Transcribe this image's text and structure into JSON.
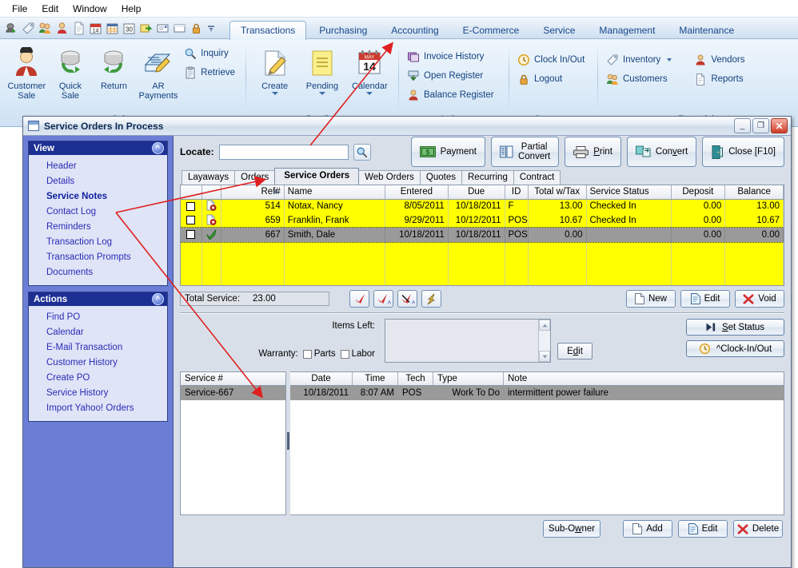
{
  "menu": {
    "items": [
      "File",
      "Edit",
      "Window",
      "Help"
    ]
  },
  "quick_toolbar": {
    "icons": [
      "customer-card-icon",
      "tag-icon",
      "customers-icon",
      "customer-icon",
      "document-icon",
      "calendar-icon",
      "spreadsheet-icon",
      "day-30-icon",
      "transfer-icon",
      "receipt-icon",
      "window-icon",
      "lock-icon",
      "dropdown-icon"
    ]
  },
  "ribbon": {
    "tabs": [
      {
        "label": "Transactions",
        "active": true
      },
      {
        "label": "Purchasing",
        "active": false
      },
      {
        "label": "Accounting",
        "active": false
      },
      {
        "label": "E-Commerce",
        "active": false
      },
      {
        "label": "Service",
        "active": false
      },
      {
        "label": "Management",
        "active": false
      },
      {
        "label": "Maintenance",
        "active": false
      }
    ],
    "groups": [
      {
        "title": "Sales",
        "big_buttons": [
          {
            "label_line1": "Customer",
            "label_line2": "Sale",
            "icon": "customer-sale-icon"
          },
          {
            "label_line1": "Quick",
            "label_line2": "Sale",
            "icon": "quick-sale-icon"
          },
          {
            "label_line1": "Return",
            "label_line2": "",
            "icon": "return-icon"
          },
          {
            "label_line1": "AR",
            "label_line2": "Payments",
            "icon": "ar-payments-icon"
          }
        ],
        "small_buttons": [
          {
            "label": "Inquiry",
            "icon": "inquiry-icon"
          },
          {
            "label": "Retrieve",
            "icon": "retrieve-icon"
          }
        ]
      },
      {
        "title": "Pending",
        "big_buttons": [
          {
            "label_line1": "Create",
            "label_line2": "",
            "icon": "create-icon",
            "caret": true
          },
          {
            "label_line1": "Pending",
            "label_line2": "",
            "icon": "pending-icon",
            "caret": true
          },
          {
            "label_line1": "Calendar",
            "label_line2": "",
            "icon": "calendar-icon",
            "caret": true
          }
        ],
        "small_buttons": []
      },
      {
        "title": "Actions",
        "big_buttons": [],
        "small_buttons": [
          {
            "label": "Invoice History",
            "icon": "invoice-history-icon"
          },
          {
            "label": "Open Register",
            "icon": "open-register-icon"
          },
          {
            "label": "Balance Register",
            "icon": "balance-register-icon"
          }
        ]
      },
      {
        "title": "Summary",
        "big_buttons": [],
        "small_buttons": [
          {
            "label": "Clock In/Out",
            "icon": "clock-icon"
          },
          {
            "label": "Logout",
            "icon": "lock-icon"
          }
        ]
      },
      {
        "title": "Essentials",
        "big_buttons": [],
        "small_buttons": [
          {
            "label": "Inventory",
            "icon": "inventory-tag-icon",
            "caret": true
          },
          {
            "label": "Customers",
            "icon": "customers-icon"
          }
        ],
        "small_buttons2": [
          {
            "label": "Vendors",
            "icon": "vendors-icon"
          },
          {
            "label": "Reports",
            "icon": "reports-icon"
          }
        ]
      }
    ]
  },
  "window": {
    "title": "Service Orders In Process",
    "minimize": "_",
    "maximize": "❐",
    "close": "✕"
  },
  "sidebar": {
    "panels": [
      {
        "title": "View",
        "items": [
          {
            "label": "Header",
            "selected": false
          },
          {
            "label": "Details",
            "selected": false
          },
          {
            "label": "Service Notes",
            "selected": true
          },
          {
            "label": "Contact Log",
            "selected": false
          },
          {
            "label": "Reminders",
            "selected": false
          },
          {
            "label": "Transaction Log",
            "selected": false
          },
          {
            "label": "Transaction Prompts",
            "selected": false
          },
          {
            "label": "Documents",
            "selected": false
          }
        ]
      },
      {
        "title": "Actions",
        "items": [
          {
            "label": "Find PO",
            "selected": false
          },
          {
            "label": "Calendar",
            "selected": false
          },
          {
            "label": "E-Mail Transaction",
            "selected": false
          },
          {
            "label": "Customer History",
            "selected": false
          },
          {
            "label": "Create PO",
            "selected": false
          },
          {
            "label": "Service History",
            "selected": false
          },
          {
            "label": "Import Yahoo! Orders",
            "selected": false
          }
        ]
      }
    ]
  },
  "locate": {
    "label": "Locate:",
    "value": "",
    "placeholder": ""
  },
  "top_buttons": [
    {
      "line1": "Payment",
      "line2": "",
      "icon": "money-icon"
    },
    {
      "line1": "Partial",
      "line2": "Convert",
      "icon": "partial-convert-icon"
    },
    {
      "line1": "Print",
      "line2": "",
      "icon": "printer-icon"
    },
    {
      "line1": "Convert",
      "line2": "",
      "icon": "convert-icon"
    },
    {
      "line1": "Close [F10]",
      "line2": "",
      "icon": "door-exit-icon"
    }
  ],
  "doc_tabs": [
    {
      "label": "Layaways",
      "active": false
    },
    {
      "label": "Orders",
      "active": false
    },
    {
      "label": "Service Orders",
      "active": true
    },
    {
      "label": "Web Orders",
      "active": false
    },
    {
      "label": "Quotes",
      "active": false
    },
    {
      "label": "Recurring",
      "active": false
    },
    {
      "label": "Contract",
      "active": false
    }
  ],
  "grid": {
    "columns": [
      "",
      "",
      "Ref#",
      "Name",
      "Entered",
      "Due",
      "ID",
      "Total w/Tax",
      "Service Status",
      "Deposit",
      "Balance"
    ],
    "sort_column": "Ref#",
    "sort_direction": "asc",
    "rows": [
      {
        "checked": false,
        "status_icon": "alert-doc-icon",
        "ref": "514",
        "name": "Notax, Nancy",
        "entered": "8/05/2011",
        "due": "10/18/2011",
        "id": "F",
        "total": "13.00",
        "service_status": "Checked In",
        "deposit": "0.00",
        "balance": "13.00",
        "selected": false
      },
      {
        "checked": false,
        "status_icon": "alert-doc-icon",
        "ref": "659",
        "name": "Franklin, Frank",
        "entered": "9/29/2011",
        "due": "10/12/2011",
        "id": "POS",
        "total": "10.67",
        "service_status": "Checked In",
        "deposit": "0.00",
        "balance": "10.67",
        "selected": false
      },
      {
        "checked": false,
        "status_icon": "green-check-icon",
        "ref": "667",
        "name": "Smith, Dale",
        "entered": "10/18/2011",
        "due": "10/18/2011",
        "id": "POS",
        "total": "0.00",
        "service_status": "",
        "deposit": "0.00",
        "balance": "0.00",
        "selected": true
      }
    ]
  },
  "total_service": {
    "label": "Total Service:",
    "value": "23.00"
  },
  "icon_buttons": [
    "check-icon",
    "check-all-icon",
    "uncheck-all-icon",
    "yellow-arrow-icon"
  ],
  "record_buttons": [
    {
      "label": "New",
      "icon": "new-doc-icon"
    },
    {
      "label": "Edit",
      "icon": "edit-doc-icon"
    },
    {
      "label": "Void",
      "icon": "void-x-icon"
    }
  ],
  "items_left": {
    "label": "Items Left:",
    "value": ""
  },
  "warranty": {
    "label": "Warranty:",
    "parts": "Parts",
    "labor": "Labor",
    "parts_checked": false,
    "labor_checked": false
  },
  "edit_small": {
    "label": "Edit"
  },
  "status_buttons": [
    {
      "label": "Set Status",
      "icon": "set-status-icon"
    },
    {
      "label": "^Clock-In/Out",
      "icon": "clock-icon"
    }
  ],
  "service_list": {
    "header": "Service #",
    "rows": [
      {
        "label": "Service-667",
        "selected": true
      }
    ]
  },
  "notes_grid": {
    "columns": [
      "Date",
      "Time",
      "Tech",
      "Type",
      "Note"
    ],
    "rows": [
      {
        "date": "10/18/2011",
        "time": "8:07 AM",
        "tech": "POS",
        "type": "Work To Do",
        "note": "intermittent power failure",
        "selected": true
      }
    ]
  },
  "bottom_buttons": [
    {
      "label": "Sub-Owner",
      "icon": "none"
    },
    {
      "label": "Add",
      "icon": "new-doc-icon"
    },
    {
      "label": "Edit",
      "icon": "edit-doc-icon"
    },
    {
      "label": "Delete",
      "icon": "delete-x-icon"
    }
  ],
  "annotations": {
    "arrow_color": "#e02020",
    "arrow1_target": "Pending ribbon button",
    "arrow2_target": "Service Orders tab",
    "arrow3_target": "Service # list"
  },
  "colors": {
    "grid_highlight": "#ffff00",
    "selection_gray": "#9a9a9a",
    "sidebar_blue": "#6b7ed6",
    "panel_header": "#1c2f93"
  }
}
